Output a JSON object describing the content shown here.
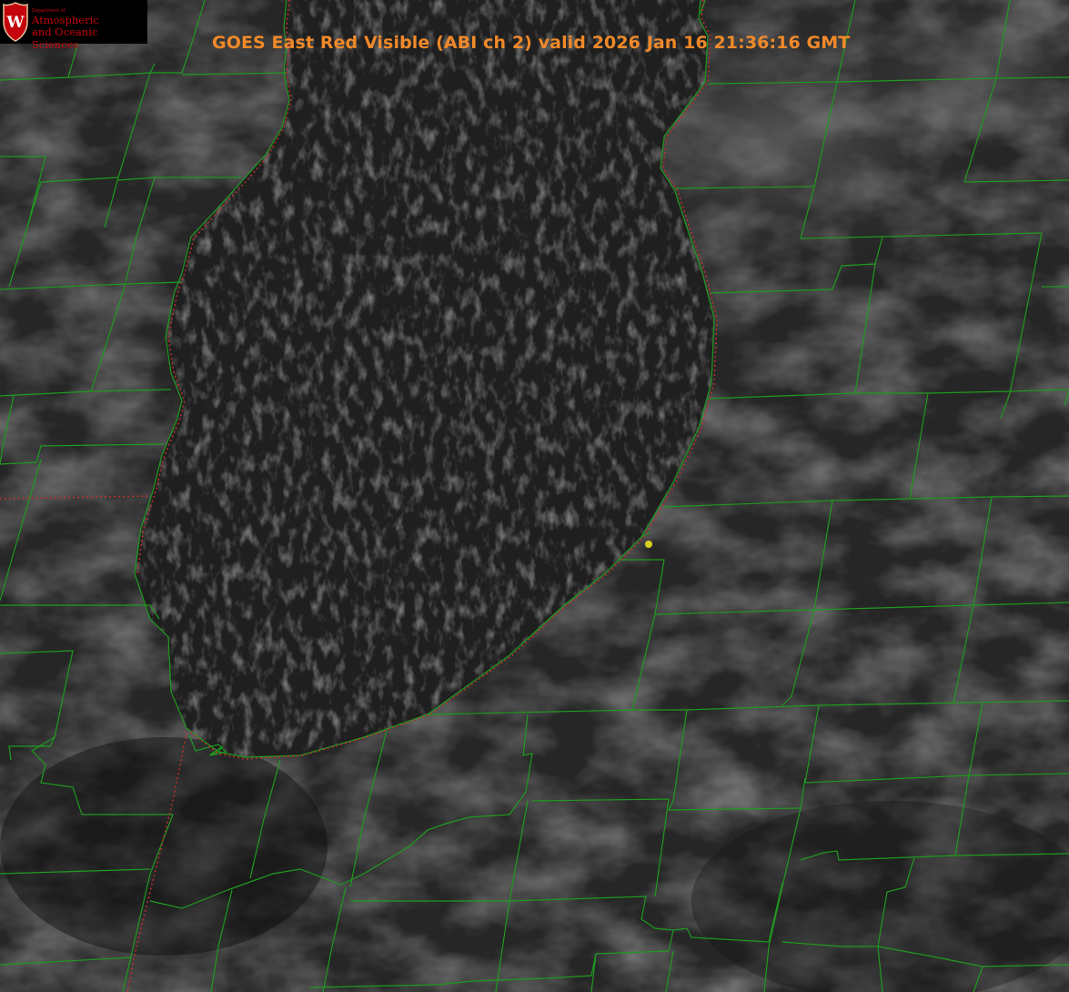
{
  "header": {
    "title": "GOES East Red Visible (ABI ch 2) valid 2026 Jan 16 21:36:16 GMT"
  },
  "logo": {
    "department": "Department of",
    "line1": "Atmospheric",
    "line2": "and Oceanic Sciences",
    "crest_letter": "W",
    "crest_icon": "uw-crest-icon",
    "text_color": "#c5050c"
  },
  "map": {
    "imagery": "visible satellite, dark grayscale",
    "county_line_color": "#1f9a1f",
    "state_line_color": "#c0302a",
    "marker_color": "#d8d020",
    "features": [
      "lake-michigan",
      "county-boundaries",
      "state-boundary-dotted",
      "location-marker"
    ]
  }
}
